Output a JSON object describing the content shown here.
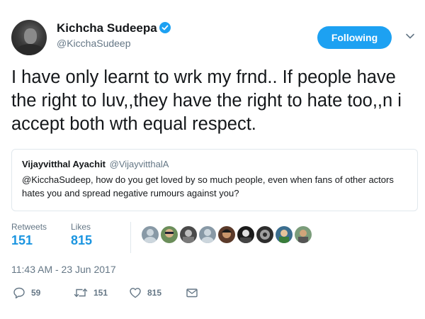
{
  "author": {
    "name": "Kichcha Sudeepa",
    "handle": "@KicchaSudeep",
    "verified": true
  },
  "follow_button": {
    "label": "Following"
  },
  "tweet": {
    "text": "I have only learnt to wrk my frnd.. If people have the right to luv,,they have the right to hate too,,n i accept both wth equal respect."
  },
  "quoted_tweet": {
    "name": "Vijayvitthal Ayachit",
    "handle": "@VijayvitthalA",
    "text": "@KicchaSudeep, how do you get loved by so much people, even when fans of other actors hates you and spread negative rumours against you?"
  },
  "stats": {
    "retweets_label": "Retweets",
    "retweets_value": "151",
    "likes_label": "Likes",
    "likes_value": "815"
  },
  "timestamp": "11:43 AM - 23 Jun 2017",
  "actions": {
    "reply_count": "59",
    "retweet_count": "151",
    "like_count": "815"
  },
  "colors": {
    "accent": "#1da1f2",
    "count_blue": "#1b95e0",
    "muted": "#657786",
    "border": "#e1e8ed"
  }
}
